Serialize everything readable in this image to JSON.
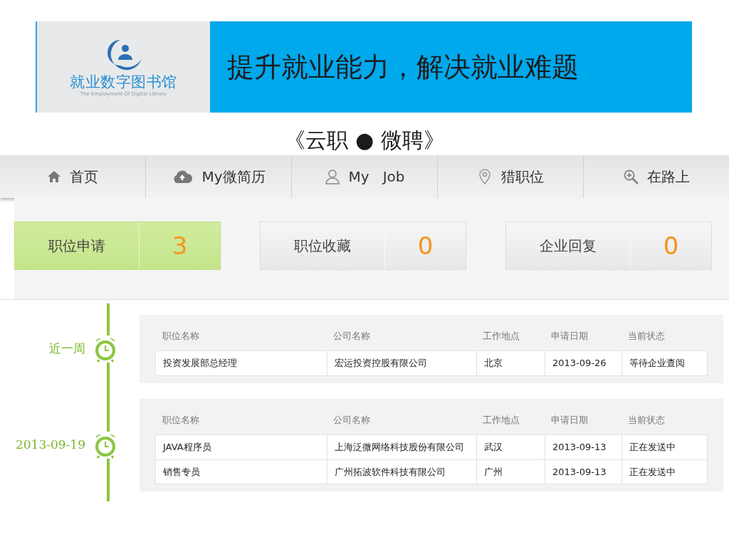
{
  "banner": {
    "logo_title": "就业数字图书馆",
    "logo_subtitle": "The Employment Of Digital Library",
    "slogan": "提升就业能力，解决就业难题"
  },
  "subtitle": "《云职 ● 微聘》",
  "nav": [
    {
      "kind": "home",
      "label": "首页"
    },
    {
      "kind": "cloud",
      "label": "My微简历"
    },
    {
      "kind": "person",
      "label": "My   Job"
    },
    {
      "kind": "pin",
      "label": "猎职位"
    },
    {
      "kind": "zoom",
      "label": "在路上"
    }
  ],
  "stats": [
    {
      "label": "职位申请",
      "count": "3",
      "selected": true
    },
    {
      "label": "职位收藏",
      "count": "0",
      "selected": false
    },
    {
      "label": "企业回复",
      "count": "0",
      "selected": false
    }
  ],
  "groups": [
    {
      "period": "近一周",
      "columns": [
        "职位名称",
        "公司名称",
        "工作地点",
        "申请日期",
        "当前状态"
      ],
      "rows": [
        [
          "投资发展部总经理",
          "宏运投资控股有限公司",
          "北京",
          "2013-09-26",
          "等待企业查阅"
        ]
      ]
    },
    {
      "period": "2013-09-19",
      "columns": [
        "职位名称",
        "公司名称",
        "工作地点",
        "申请日期",
        "当前状态"
      ],
      "rows": [
        [
          "JAVA程序员",
          "上海泛微网络科技股份有限公司",
          "武汉",
          "2013-09-13",
          "正在发送中"
        ],
        [
          "销售专员",
          "广州拓波软件科技有限公司",
          "广州",
          "2013-09-13",
          "正在发送中"
        ]
      ]
    }
  ]
}
